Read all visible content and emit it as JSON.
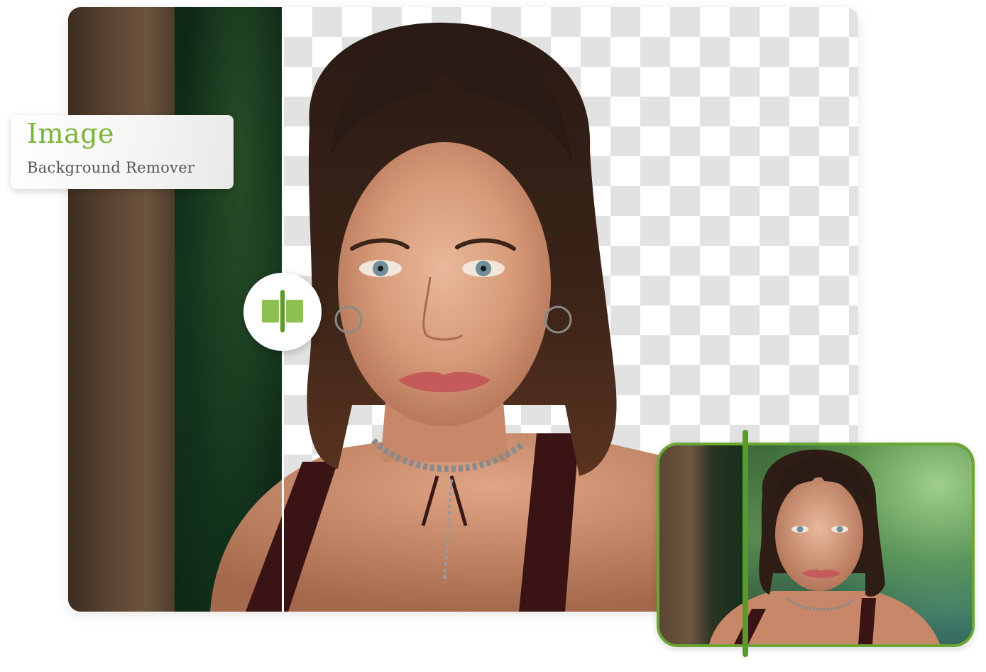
{
  "label": {
    "title": "Image",
    "subtitle": "Background Remover"
  },
  "colors": {
    "accent": "#7bb43a",
    "accent_dark": "#5a9a2a",
    "subtitle_text": "#555555",
    "checker": "#e2e2e2"
  },
  "icons": {
    "slider_handle": "compare-slider-icon"
  },
  "images": {
    "main": "portrait-of-woman-with-background-removed-comparison",
    "thumbnail": "original-portrait-with-garden-background"
  }
}
